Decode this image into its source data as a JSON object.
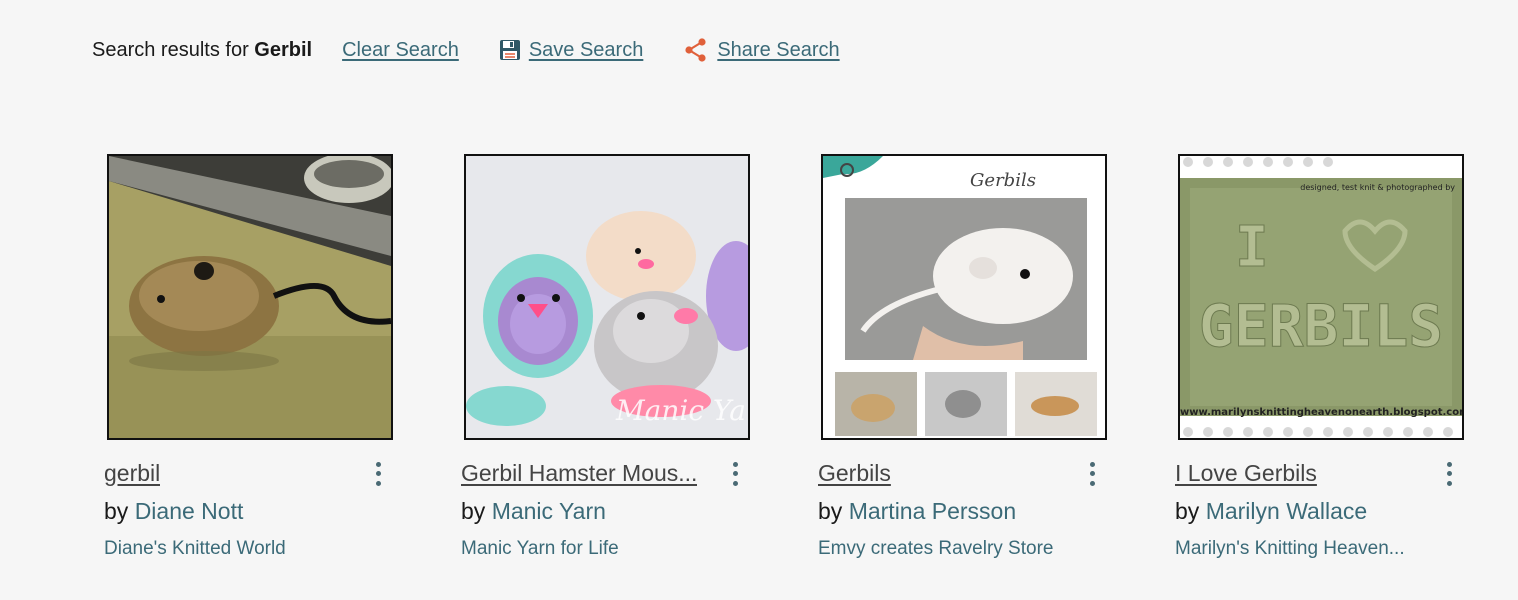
{
  "search": {
    "prefix": "Search results for",
    "term": "Gerbil",
    "clear_label": "Clear Search",
    "save_label": "Save Search",
    "share_label": "Share Search"
  },
  "cards": [
    {
      "title": "gerbil",
      "by": "by",
      "designer": "Diane Nott",
      "source": "Diane's Knitted World"
    },
    {
      "title": "Gerbil Hamster Mous...",
      "by": "by",
      "designer": "Manic Yarn",
      "source": "Manic Yarn for Life",
      "image_caption": "Manic Yarn"
    },
    {
      "title": "Gerbils",
      "by": "by",
      "designer": "Martina Persson",
      "source": "Emvy creates Ravelry Store",
      "image_heading": "Gerbils"
    },
    {
      "title": "I Love Gerbils",
      "by": "by",
      "designer": "Marilyn Wallace",
      "source": "Marilyn's Knitting Heaven...",
      "image_header_text": "designed, test knit & photographed by",
      "image_word_top": "I",
      "image_word_bottom": "GERBILS",
      "image_footer_text": "www.marilynsknittingheavenonearth.blogspot.com"
    }
  ],
  "colors": {
    "link": "#3b6a78",
    "background": "#f6f6f6",
    "share_icon": "#e0603a"
  }
}
